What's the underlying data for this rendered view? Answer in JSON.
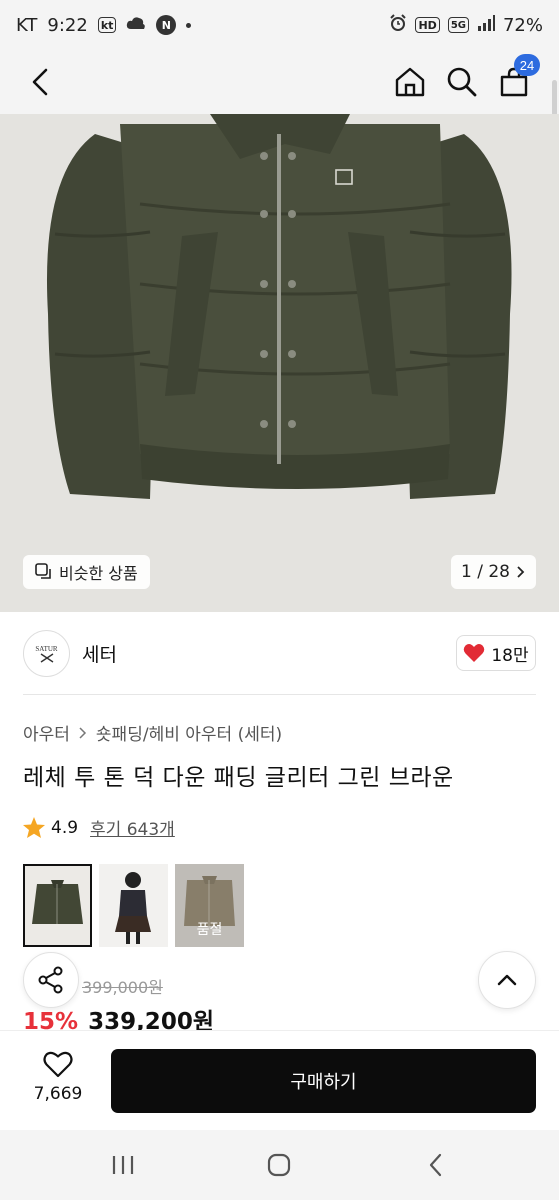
{
  "status_bar": {
    "carrier": "KT",
    "time": "9:22",
    "kt_badge": "kt",
    "n_badge": "N",
    "hd_badge": "HD",
    "network": "5G",
    "battery": "72%"
  },
  "header": {
    "cart_count": "24"
  },
  "gallery": {
    "similar_label": "비슷한 상품",
    "counter": "1 / 28"
  },
  "brand": {
    "name": "세터",
    "logo_text": "SATUR",
    "likes": "18만"
  },
  "product": {
    "breadcrumb": [
      "아우터",
      "숏패딩/헤비 아우터 (세터)"
    ],
    "title": "레체 투 톤 덕 다운 패딩 글리터 그린 브라운",
    "rating": "4.9",
    "reviews": "후기 643개",
    "thumbs": [
      {
        "alt": "green jacket",
        "selected": true
      },
      {
        "alt": "model",
        "selected": false
      },
      {
        "alt": "brown jacket",
        "selected": false,
        "badge": "품절"
      }
    ],
    "original_price": "399,000원",
    "discount": "15%",
    "price": "339,200원"
  },
  "bottom": {
    "wish_count": "7,669",
    "buy_label": "구매하기"
  },
  "colors": {
    "accent_blue": "#2d6bdf",
    "discount_red": "#e7313a",
    "heart_red": "#e22b35",
    "star_orange": "#f5a623"
  }
}
